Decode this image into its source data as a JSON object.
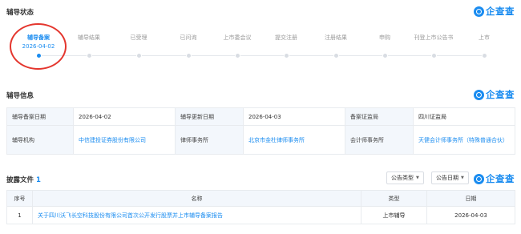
{
  "brand": {
    "name": "企查查"
  },
  "status": {
    "title": "辅导状态",
    "steps": [
      {
        "label": "辅导备案",
        "date": "2026-04-02"
      },
      {
        "label": "辅导结果"
      },
      {
        "label": "已受理"
      },
      {
        "label": "已问询"
      },
      {
        "label": "上市委会议"
      },
      {
        "label": "提交注册"
      },
      {
        "label": "注册结果"
      },
      {
        "label": "申购"
      },
      {
        "label": "刊登上市公告书"
      },
      {
        "label": "上市"
      }
    ]
  },
  "info": {
    "title": "辅导信息",
    "filing_date_label": "辅导备案日期",
    "filing_date": "2026-04-02",
    "update_date_label": "辅导更新日期",
    "update_date": "2026-04-03",
    "regulator_label": "备案证监局",
    "regulator": "四川证监局",
    "agency_label": "辅导机构",
    "agency": "中信建投证券股份有限公司",
    "law_firm_label": "律师事务所",
    "law_firm": "北京市金杜律师事务所",
    "accountant_label": "会计师事务所",
    "accountant": "天健会计师事务所（特殊普通合伙）"
  },
  "disclosure": {
    "title": "披露文件",
    "count": "1",
    "filter_type": "公告类型",
    "filter_date": "公告日期",
    "columns": [
      "序号",
      "名称",
      "类型",
      "日期"
    ],
    "rows": [
      {
        "index": "1",
        "name": "关于四川沃飞长空科技股份有限公司首次公开发行股票并上市辅导备案报告",
        "type": "上市辅导",
        "date": "2026-04-03"
      }
    ]
  }
}
